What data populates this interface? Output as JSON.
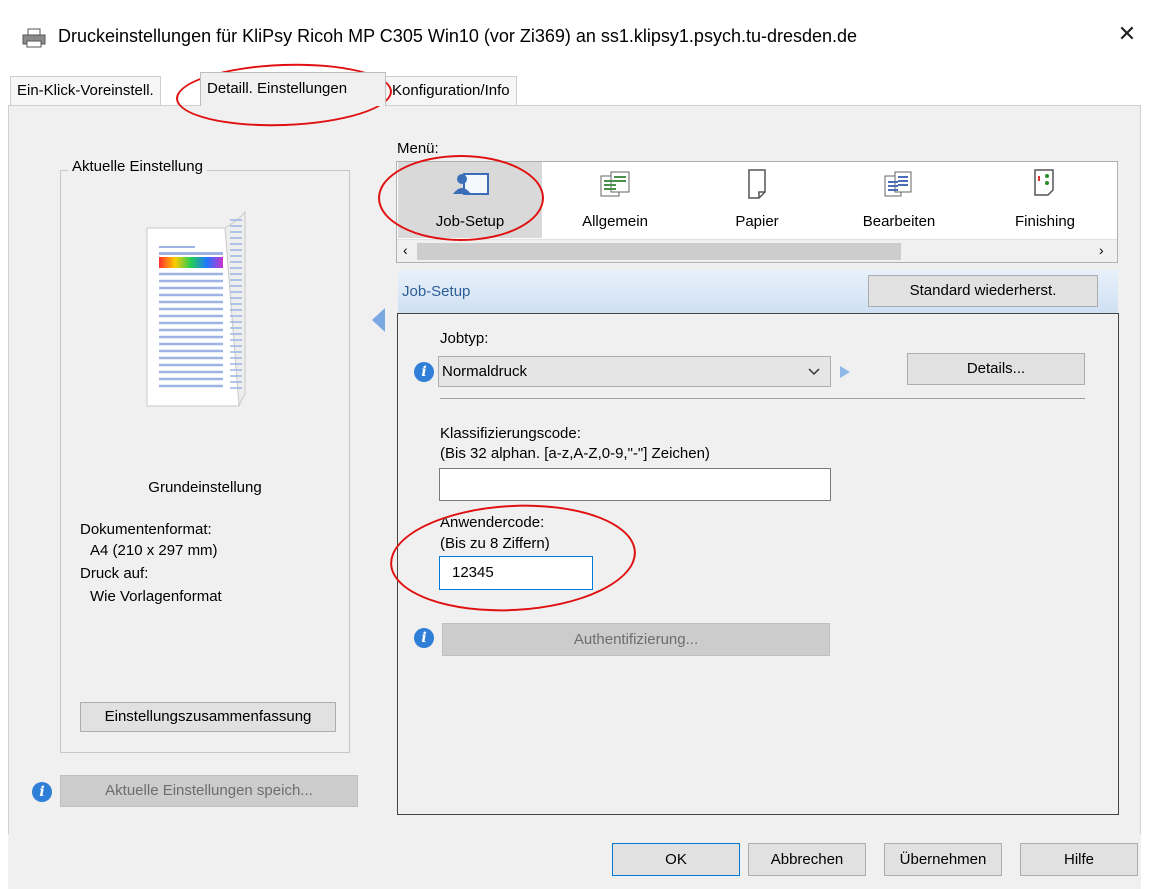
{
  "window": {
    "title": "Druckeinstellungen für KliPsy Ricoh MP C305 Win10 (vor Zi369) an ss1.klipsy1.psych.tu-dresden.de",
    "close_glyph": "✕"
  },
  "tabs": [
    {
      "label": "Ein-Klick-Voreinstell."
    },
    {
      "label": "Detaill. Einstellungen"
    },
    {
      "label": "Konfiguration/Info"
    }
  ],
  "left_panel": {
    "group_title": "Aktuelle Einstellung",
    "preview_name": "Grundeinstellung",
    "doc_format_label": "Dokumentenformat:",
    "doc_format_value": "A4 (210 x 297 mm)",
    "print_on_label": "Druck auf:",
    "print_on_value": "Wie Vorlagenformat",
    "summary_button": "Einstellungszusammenfassung",
    "save_button": "Aktuelle Einstellungen speich..."
  },
  "menu": {
    "label": "Menü:",
    "items": [
      {
        "label": "Job-Setup"
      },
      {
        "label": "Allgemein"
      },
      {
        "label": "Papier"
      },
      {
        "label": "Bearbeiten"
      },
      {
        "label": "Finishing"
      }
    ]
  },
  "section": {
    "title": "Job-Setup",
    "restore_button": "Standard wiederherst."
  },
  "job_setup": {
    "jobtype_label": "Jobtyp:",
    "jobtype_value": "Normaldruck",
    "details_button": "Details...",
    "class_code_label": "Klassifizierungscode:",
    "class_code_hint": "(Bis 32 alphan. [a-z,A-Z,0-9,\"-\"] Zeichen)",
    "class_code_value": "",
    "user_code_label": "Anwendercode:",
    "user_code_hint": "(Bis zu 8 Ziffern)",
    "user_code_value": "12345",
    "auth_button": "Authentifizierung..."
  },
  "footer": {
    "ok": "OK",
    "cancel": "Abbrechen",
    "apply": "Übernehmen",
    "help": "Hilfe"
  },
  "colors": {
    "accent": "#0078d7",
    "annotation": "#e01010",
    "info": "#2f7fd8"
  }
}
